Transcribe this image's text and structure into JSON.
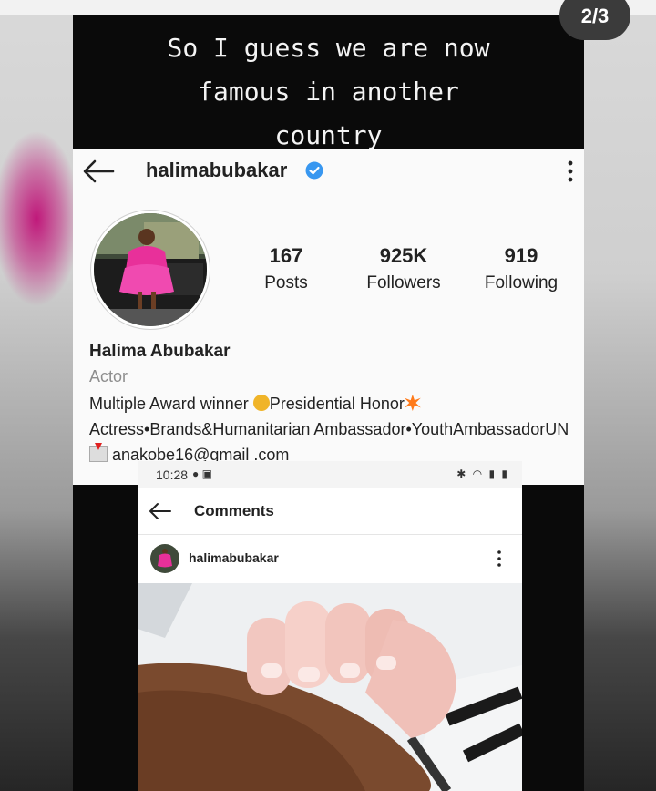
{
  "story": {
    "counter": "2/3",
    "caption": "So I guess we are now\nfamous in another\ncountry"
  },
  "profile": {
    "username": "halimabubakar",
    "stats": [
      {
        "value": "167",
        "label": "Posts"
      },
      {
        "value": "925K",
        "label": "Followers"
      },
      {
        "value": "919",
        "label": "Following"
      }
    ],
    "name": "Halima Abubakar",
    "category": "Actor",
    "bio": {
      "part1": "Multiple Award winner ",
      "part2": "Presidential Honor",
      "part3": "Actress•Brands&Humanitarian Ambassador•YouthAmbassadorUN",
      "part4": " anakobe16@gmail .com"
    }
  },
  "embedded_screenshot": {
    "status_time": "10:28",
    "title": "Comments",
    "post_username": "halimabubakar"
  },
  "colors": {
    "verified_badge": "#3897f0",
    "dress_pink": "#e8309a",
    "story_background": "#0a0a0a"
  },
  "icons": [
    "back-arrow-icon",
    "verified-badge-icon",
    "more-options-icon",
    "wifi-icon",
    "battery-icon"
  ]
}
